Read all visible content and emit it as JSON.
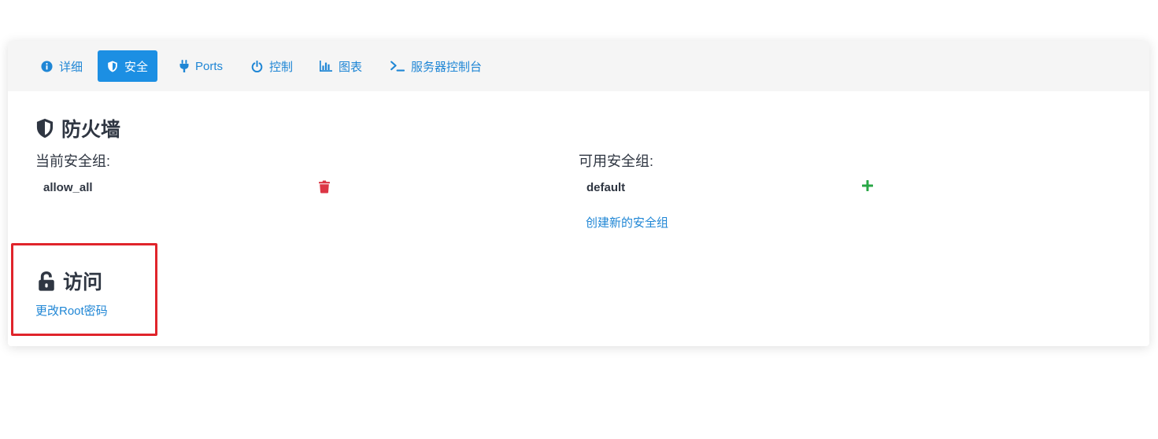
{
  "tabs": [
    {
      "label": "详细",
      "icon": "info-circle-icon"
    },
    {
      "label": "安全",
      "icon": "shield-icon",
      "active": true
    },
    {
      "label": "Ports",
      "icon": "plug-icon"
    },
    {
      "label": "控制",
      "icon": "power-icon"
    },
    {
      "label": "图表",
      "icon": "bar-chart-icon"
    },
    {
      "label": "服务器控制台",
      "icon": "terminal-icon"
    }
  ],
  "firewall": {
    "title": "防火墙",
    "current_label": "当前安全组:",
    "current_groups": [
      {
        "name": "allow_all",
        "action_icon": "trash-icon"
      }
    ],
    "available_label": "可用安全组:",
    "available_groups": [
      {
        "name": "default",
        "action_icon": "plus-icon"
      }
    ],
    "create_link": "创建新的安全组"
  },
  "access": {
    "title": "访问",
    "change_root_link": "更改Root密码"
  },
  "colors": {
    "accent": "#1c8fe3",
    "link": "#1f86d5",
    "danger": "#dc3545",
    "success": "#28a745",
    "highlight": "#e0242b"
  }
}
